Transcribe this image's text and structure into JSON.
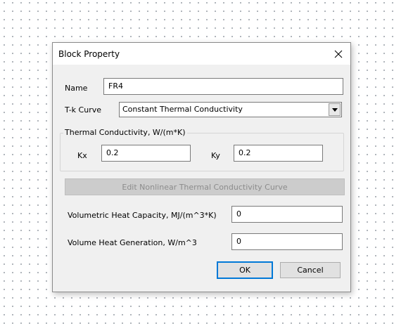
{
  "dialog": {
    "title": "Block Property",
    "name_label": "Name",
    "name_value": "FR4",
    "tk_label": "T-k Curve",
    "tk_value": "Constant Thermal Conductivity",
    "conductivity_group_label": "Thermal Conductivity, W/(m*K)",
    "kx_label": "Kx",
    "kx_value": "0.2",
    "ky_label": "Ky",
    "ky_value": "0.2",
    "edit_curve_button": "Edit Nonlinear Thermal Conductivity Curve",
    "vol_heat_capacity_label": "Volumetric Heat Capacity, MJ/(m^3*K)",
    "vol_heat_capacity_value": "0",
    "vol_heat_gen_label": "Volume Heat Generation, W/m^3",
    "vol_heat_gen_value": "0",
    "ok_button": "OK",
    "cancel_button": "Cancel"
  },
  "icons": {
    "close": "close-icon",
    "dropdown": "chevron-down-icon"
  },
  "colors": {
    "dialog_bg": "#f0f0f0",
    "default_button_border": "#0078d7",
    "grid_dots": "#9aa0a8"
  }
}
